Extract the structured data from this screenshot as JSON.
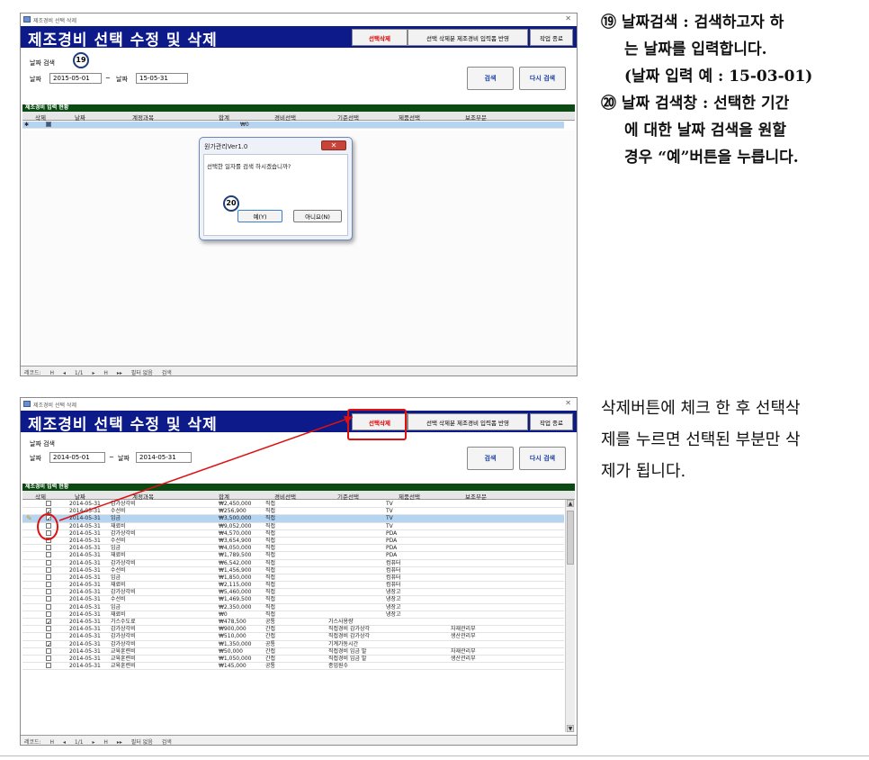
{
  "window_title": "제조경비 선택 삭제",
  "header_title": "제조경비 선택 수정 및 삭제",
  "buttons": {
    "select_delete": "선택삭제",
    "reflect": "선택 삭제분 제조경비 입력폼 반영",
    "exit": "작업 종료",
    "search": "검색",
    "research": "다시 검색"
  },
  "date_search_label": "날짜 검색",
  "date_label_from": "날짜",
  "date_label_to": "날짜",
  "tilde": "~",
  "section_title": "제조경비 입력 현황",
  "columns": [
    "삭제",
    "날짜",
    "계정과목",
    "합계",
    "경비선택",
    "기준선택",
    "제품선택",
    "보조부문"
  ],
  "screen1": {
    "date_from": "2015-05-01",
    "date_to": "15-05-31",
    "empty_total": "₩0",
    "new_row_marker": "✱",
    "marker_19": "19",
    "marker_20": "20",
    "status": {
      "record_label": "레코드:",
      "nav_first": "H",
      "nav_prev": "◂",
      "position": "1/1",
      "nav_next": "▸",
      "nav_last": "H",
      "nav_new": "▸▸",
      "filter": "필터 없음",
      "search": "검색"
    },
    "dialog": {
      "title": "원가관리Ver1.0",
      "close": "✕",
      "message": "선택한 일자를 검색 하시겠습니까?",
      "yes": "예(Y)",
      "no": "아니요(N)"
    }
  },
  "screen2": {
    "date_from": "2014-05-01",
    "date_to": "2014-05-31",
    "row_pointer": "✎",
    "rows": [
      {
        "del": false,
        "date": "2014-05-31",
        "account": "감가상각비",
        "total": "₩2,450,000",
        "expense": "직접",
        "basis": "",
        "product": "TV",
        "aux": ""
      },
      {
        "del": true,
        "date": "2014-05-31",
        "account": "수선비",
        "total": "₩256,900",
        "expense": "직접",
        "basis": "",
        "product": "TV",
        "aux": ""
      },
      {
        "del": true,
        "date": "2014-05-31",
        "account": "임금",
        "total": "₩3,500,000",
        "expense": "직접",
        "basis": "",
        "product": "TV",
        "aux": "",
        "selected": true
      },
      {
        "del": false,
        "date": "2014-05-31",
        "account": "재료비",
        "total": "₩9,052,000",
        "expense": "직접",
        "basis": "",
        "product": "TV",
        "aux": ""
      },
      {
        "del": false,
        "date": "2014-05-31",
        "account": "감가상각비",
        "total": "₩4,570,000",
        "expense": "직접",
        "basis": "",
        "product": "PDA",
        "aux": ""
      },
      {
        "del": false,
        "date": "2014-05-31",
        "account": "수선비",
        "total": "₩3,654,900",
        "expense": "직접",
        "basis": "",
        "product": "PDA",
        "aux": ""
      },
      {
        "del": false,
        "date": "2014-05-31",
        "account": "임금",
        "total": "₩4,050,000",
        "expense": "직접",
        "basis": "",
        "product": "PDA",
        "aux": ""
      },
      {
        "del": false,
        "date": "2014-05-31",
        "account": "재료비",
        "total": "₩1,789,500",
        "expense": "직접",
        "basis": "",
        "product": "PDA",
        "aux": ""
      },
      {
        "del": false,
        "date": "2014-05-31",
        "account": "감가상각비",
        "total": "₩6,542,000",
        "expense": "직접",
        "basis": "",
        "product": "컴퓨터",
        "aux": ""
      },
      {
        "del": false,
        "date": "2014-05-31",
        "account": "수선비",
        "total": "₩1,456,900",
        "expense": "직접",
        "basis": "",
        "product": "컴퓨터",
        "aux": ""
      },
      {
        "del": false,
        "date": "2014-05-31",
        "account": "임금",
        "total": "₩1,850,000",
        "expense": "직접",
        "basis": "",
        "product": "컴퓨터",
        "aux": ""
      },
      {
        "del": false,
        "date": "2014-05-31",
        "account": "재료비",
        "total": "₩2,115,000",
        "expense": "직접",
        "basis": "",
        "product": "컴퓨터",
        "aux": ""
      },
      {
        "del": false,
        "date": "2014-05-31",
        "account": "감가상각비",
        "total": "₩5,460,000",
        "expense": "직접",
        "basis": "",
        "product": "냉장고",
        "aux": ""
      },
      {
        "del": false,
        "date": "2014-05-31",
        "account": "수선비",
        "total": "₩1,469,500",
        "expense": "직접",
        "basis": "",
        "product": "냉장고",
        "aux": ""
      },
      {
        "del": false,
        "date": "2014-05-31",
        "account": "임금",
        "total": "₩2,350,000",
        "expense": "직접",
        "basis": "",
        "product": "냉장고",
        "aux": ""
      },
      {
        "del": false,
        "date": "2014-05-31",
        "account": "재료비",
        "total": "₩0",
        "expense": "직접",
        "basis": "",
        "product": "냉장고",
        "aux": ""
      },
      {
        "del": true,
        "date": "2014-05-31",
        "account": "가스수도료",
        "total": "₩478,500",
        "expense": "공통",
        "basis": "가스사용량",
        "product": "",
        "aux": ""
      },
      {
        "del": false,
        "date": "2014-05-31",
        "account": "감가상각비",
        "total": "₩900,000",
        "expense": "간접",
        "basis": "직접경비 감가상각",
        "product": "",
        "aux": "자재관리부"
      },
      {
        "del": false,
        "date": "2014-05-31",
        "account": "감가상각비",
        "total": "₩510,000",
        "expense": "간접",
        "basis": "직접경비 감가상각",
        "product": "",
        "aux": "생산관리부"
      },
      {
        "del": true,
        "date": "2014-05-31",
        "account": "감가상각비",
        "total": "₩1,350,000",
        "expense": "공통",
        "basis": "기계가동시간",
        "product": "",
        "aux": ""
      },
      {
        "del": false,
        "date": "2014-05-31",
        "account": "교육훈련비",
        "total": "₩50,000",
        "expense": "간접",
        "basis": "직접경비 임금 발",
        "product": "",
        "aux": "자재관리부"
      },
      {
        "del": false,
        "date": "2014-05-31",
        "account": "교육훈련비",
        "total": "₩1,050,000",
        "expense": "간접",
        "basis": "직접경비 임금 발",
        "product": "",
        "aux": "생산관리부"
      },
      {
        "del": false,
        "date": "2014-05-31",
        "account": "교육훈련비",
        "total": "₩145,000",
        "expense": "공통",
        "basis": "종업원수",
        "product": "",
        "aux": ""
      }
    ],
    "status": {
      "record_label": "레코드:",
      "nav_first": "H",
      "nav_prev": "◂",
      "position": "1/1",
      "nav_next": "▸",
      "nav_last": "H",
      "nav_new": "▸▸",
      "filter": "필터 없음",
      "search": "검색"
    }
  },
  "text_right_top": [
    "⑲ 날짜검색 : 검색하고자 하",
    "는 날짜를 입력합니다.",
    "(날짜 입력 예 : 15-03-01)",
    "⑳ 날짜 검색창 : 선택한 기간",
    "에 대한 날짜 검색을 원할",
    "경우 “예”버튼을 누릅니다."
  ],
  "text_right_bottom": [
    "삭제버튼에 체크 한 후 선택삭",
    "제를 누르면 선택된 부분만 삭",
    "제가 됩니다."
  ],
  "colors": {
    "header": "#0d1a8a",
    "section": "#0b4a12",
    "highlight": "#d11111",
    "selected_row": "#b5d4f2"
  }
}
